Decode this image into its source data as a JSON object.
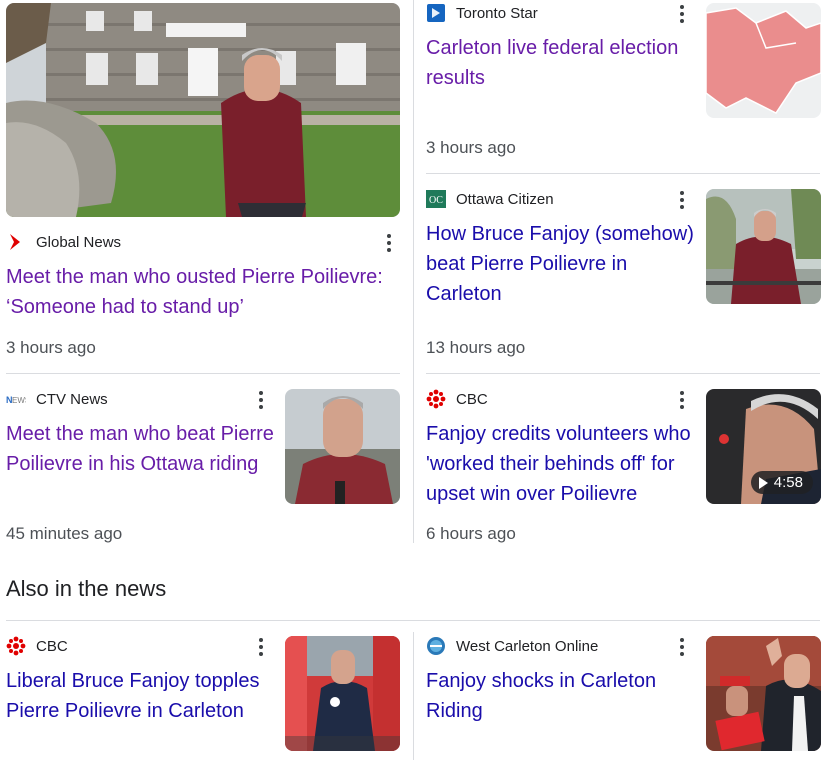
{
  "stories": [
    {
      "source": "Global News",
      "logo": "global-news-logo",
      "headline": "Meet the man who ousted Pierre Poilievre: ‘Someone had to stand up’",
      "time": "3 hours ago",
      "visited": true
    },
    {
      "source": "Toronto Star",
      "logo": "toronto-star-logo",
      "headline": "Carleton live federal election results",
      "time": "3 hours ago",
      "visited": true
    },
    {
      "source": "Ottawa Citizen",
      "logo": "ottawa-citizen-logo",
      "headline": "How Bruce Fanjoy (somehow) beat Pierre Poilievre in Carleton",
      "time": "13 hours ago",
      "visited": false
    },
    {
      "source": "CTV News",
      "logo": "ctv-news-logo",
      "headline": "Meet the man who beat Pierre Poilievre in his Ottawa riding",
      "time": "45 minutes ago",
      "visited": true
    },
    {
      "source": "CBC",
      "logo": "cbc-logo",
      "headline": "Fanjoy credits volunteers who 'worked their behinds off' for upset win over Poilievre",
      "time": "6 hours ago",
      "visited": false,
      "video_duration": "4:58"
    }
  ],
  "also_in_news": {
    "title": "Also in the news",
    "stories": [
      {
        "source": "CBC",
        "logo": "cbc-logo",
        "headline": "Liberal Bruce Fanjoy topples Pierre Poilievre in Carleton",
        "visited": false
      },
      {
        "source": "West Carleton Online",
        "logo": "west-carleton-online-logo",
        "headline": "Fanjoy shocks in Carleton Riding",
        "visited": false
      }
    ]
  },
  "colors": {
    "visited": "#681da8",
    "unvisited": "#1a0dab",
    "cbc_red": "#e00000",
    "toronto_star_blue": "#1565c0",
    "ottawa_citizen_green": "#1f7a5a"
  }
}
